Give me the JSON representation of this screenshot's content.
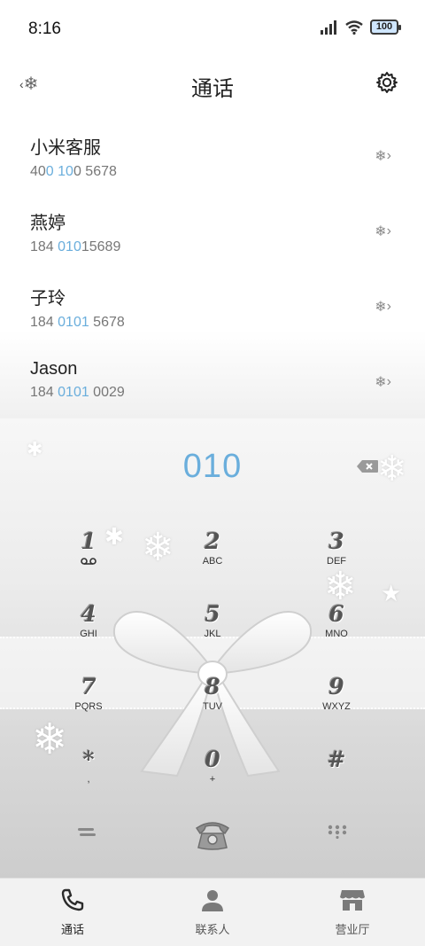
{
  "status_bar": {
    "time": "8:16",
    "battery": "100"
  },
  "header": {
    "title": "通话"
  },
  "call_list": [
    {
      "name": "小米客服",
      "number_parts": [
        "40",
        "0",
        " ",
        "10",
        "0 5678"
      ]
    },
    {
      "name": "燕婷",
      "number_parts": [
        "184 ",
        "010",
        "15689"
      ]
    },
    {
      "name": "子玲",
      "number_parts": [
        "184 ",
        "0101",
        " 5678"
      ]
    },
    {
      "name": "Jason",
      "number_parts": [
        "184 ",
        "0101",
        " 0029"
      ]
    }
  ],
  "dialer": {
    "input": "010",
    "keys": [
      {
        "digit": "1",
        "letters": ""
      },
      {
        "digit": "2",
        "letters": "ABC"
      },
      {
        "digit": "3",
        "letters": "DEF"
      },
      {
        "digit": "4",
        "letters": "GHI"
      },
      {
        "digit": "5",
        "letters": "JKL"
      },
      {
        "digit": "6",
        "letters": "MNO"
      },
      {
        "digit": "7",
        "letters": "PQRS"
      },
      {
        "digit": "8",
        "letters": "TUV"
      },
      {
        "digit": "9",
        "letters": "WXYZ"
      },
      {
        "digit": "*",
        "letters": ","
      },
      {
        "digit": "0",
        "letters": "+"
      },
      {
        "digit": "#",
        "letters": ""
      }
    ]
  },
  "tabs": [
    {
      "label": "通话",
      "icon": "phone-icon",
      "active": true
    },
    {
      "label": "联系人",
      "icon": "contact-icon",
      "active": false
    },
    {
      "label": "营业厅",
      "icon": "store-icon",
      "active": false
    }
  ],
  "colors": {
    "accent": "#6aaedc",
    "tab_active": "#222222"
  }
}
